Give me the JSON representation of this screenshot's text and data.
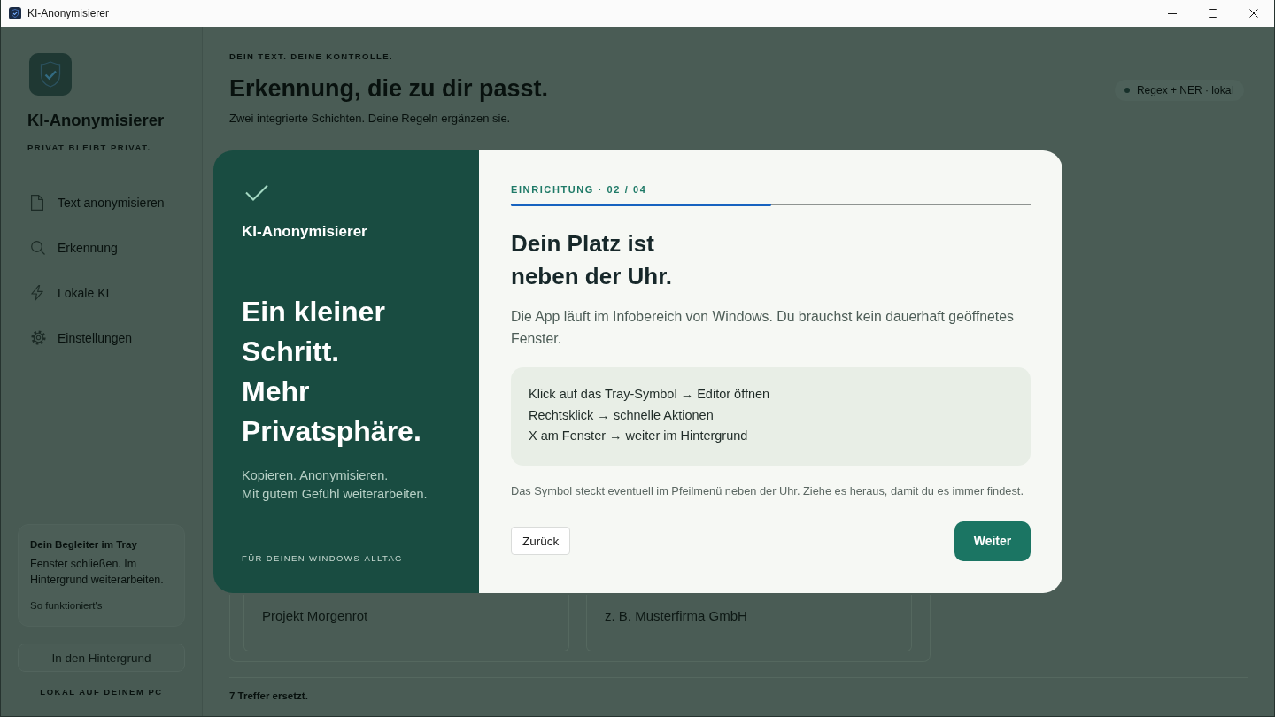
{
  "window": {
    "title": "KI-Anonymisierer"
  },
  "sidebar": {
    "app_name": "KI-Anonymisierer",
    "tagline": "PRIVAT BLEIBT PRIVAT.",
    "nav_items": [
      {
        "label": "Text anonymisieren"
      },
      {
        "label": "Erkennung"
      },
      {
        "label": "Lokale KI"
      },
      {
        "label": "Einstellungen"
      }
    ],
    "tray_card": {
      "title": "Dein Begleiter im Tray",
      "text": "Fenster schließen. Im Hintergrund weiterarbeiten.",
      "link": "So funktioniert's"
    },
    "background_button": "In den Hintergrund",
    "footer": "LOKAL AUF DEINEM PC"
  },
  "header": {
    "eyebrow": "DEIN TEXT. DEINE KONTROLLE.",
    "title": "Erkennung, die zu dir passt.",
    "subtitle": "Zwei integrierte Schichten. Deine Regeln ergänzen sie.",
    "badge": "Regex + NER · lokal"
  },
  "form": {
    "fields": [
      {
        "placeholder": "Projekt Morgenrot"
      },
      {
        "placeholder": "z. B. Musterfirma GmbH"
      }
    ]
  },
  "status_bar": {
    "text": "7 Treffer ersetzt."
  },
  "dialog": {
    "brand": "KI-Anonymisierer",
    "headline": "Ein kleiner Schritt.\nMehr Privatsphäre.",
    "tagline": "Kopieren. Anonymisieren.\nMit gutem Gefühl weiterarbeiten.",
    "footer": "FÜR DEINEN WINDOWS-ALLTAG",
    "step": {
      "label": "EINRICHTUNG · 02 / 04",
      "level": 0.5
    },
    "title": "Dein Platz ist\nneben der Uhr.",
    "body": "Die App läuft im Infobereich von Windows. Du brauchst kein dauerhaft geöffnetes Fenster.",
    "tips": [
      "Klick auf das Tray-Symbol → Editor öffnen",
      "Rechtsklick → schnelle Aktionen",
      "X am Fenster → weiter im Hintergrund"
    ],
    "hint": "Das Symbol steckt eventuell im Pfeilmenü neben der Uhr. Ziehe es heraus, damit du es immer findest.",
    "buttons": [
      {
        "label": "Zurück",
        "kind": "secondary"
      },
      {
        "label": "Weiter",
        "kind": "primary"
      }
    ]
  }
}
